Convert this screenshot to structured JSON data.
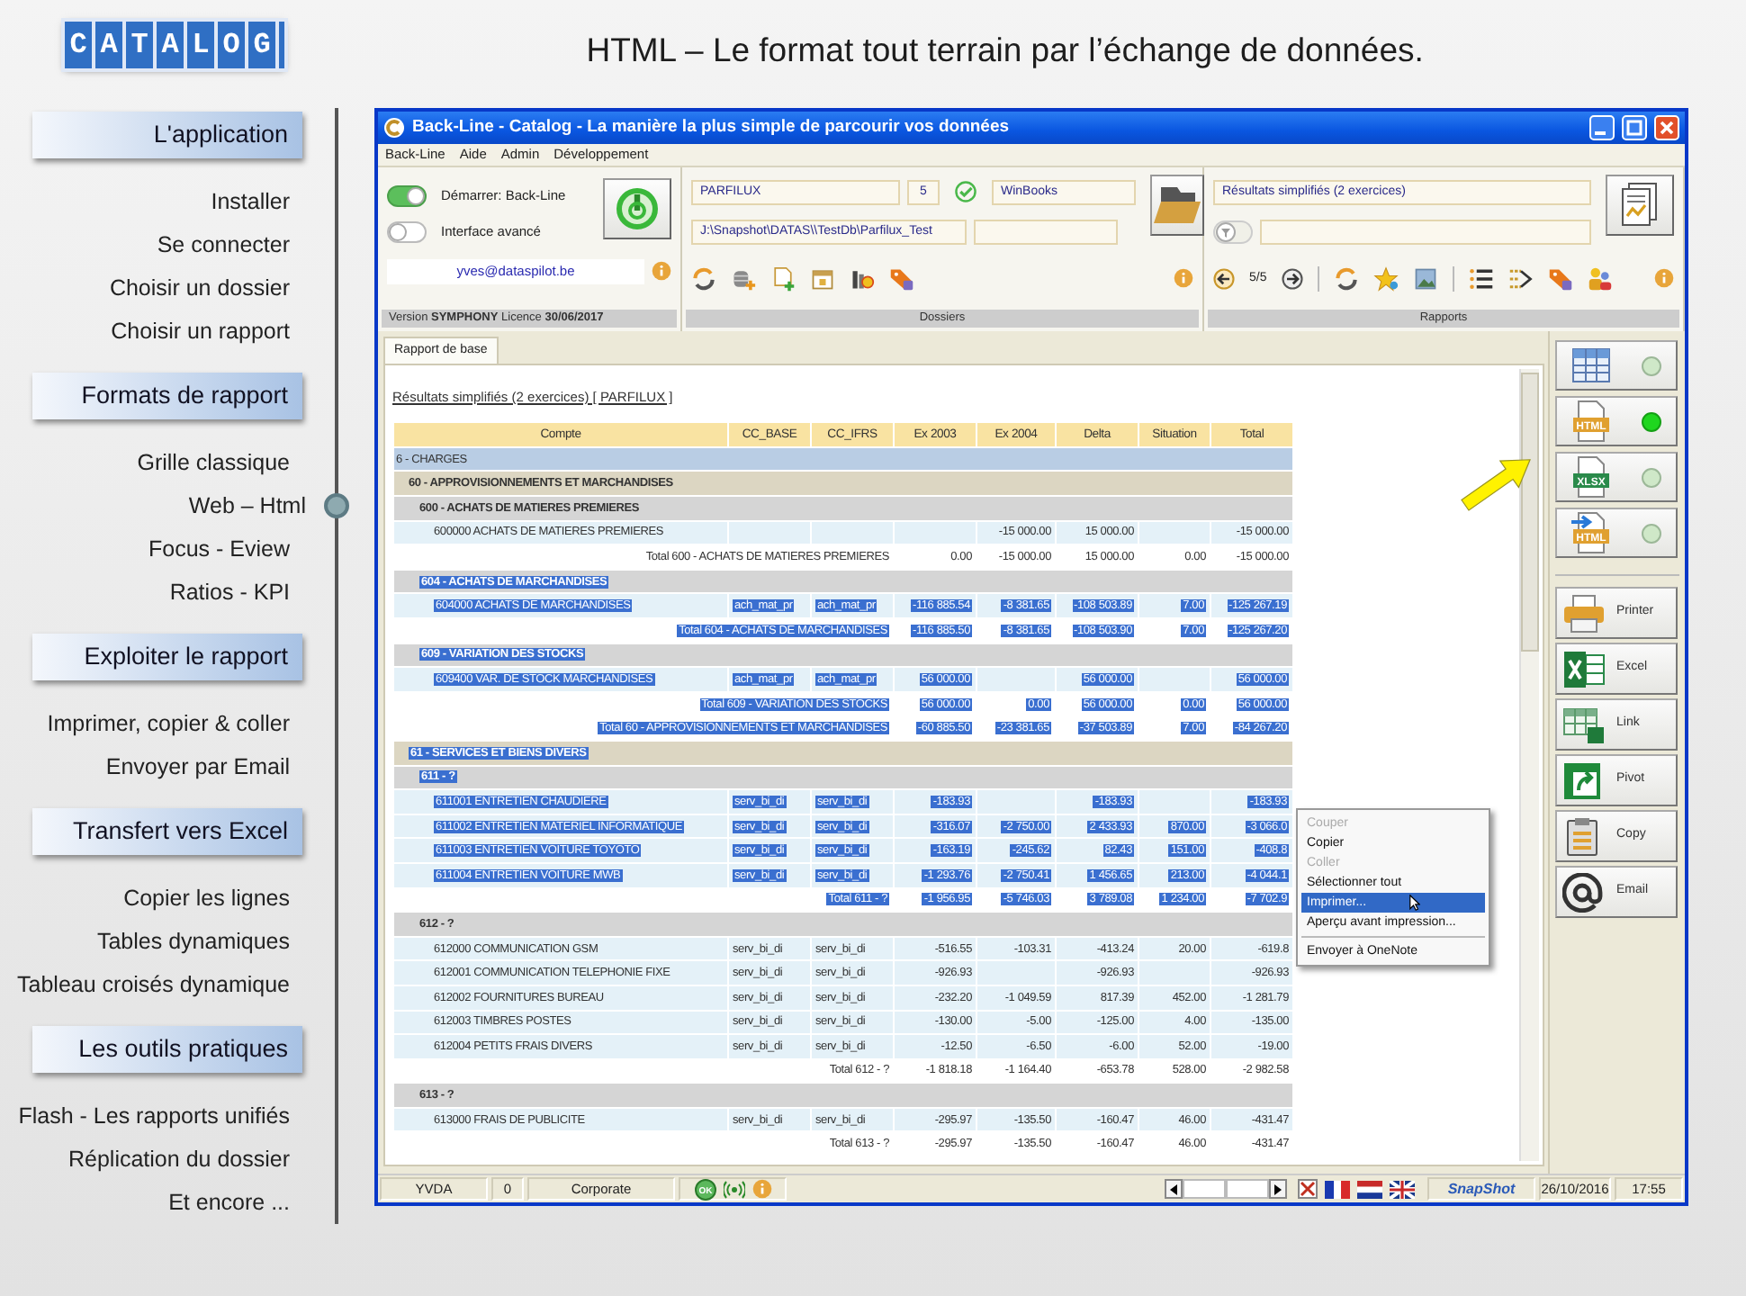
{
  "logo": "CATALOG",
  "headline": "HTML – Le format tout terrain par l’échange de données.",
  "sidebar": {
    "sections": [
      {
        "title": "L'application",
        "items": [
          {
            "label": "Installer",
            "selected": false
          },
          {
            "label": "Se connecter",
            "selected": false
          },
          {
            "label": "Choisir un dossier",
            "selected": false
          },
          {
            "label": "Choisir un rapport",
            "selected": false
          }
        ]
      },
      {
        "title": "Formats de rapport",
        "items": [
          {
            "label": "Grille classique",
            "selected": false
          },
          {
            "label": "Web – Html",
            "selected": true
          },
          {
            "label": "Focus - Eview",
            "selected": false
          },
          {
            "label": "Ratios - KPI",
            "selected": false
          }
        ]
      },
      {
        "title": "Exploiter le rapport",
        "items": [
          {
            "label": "Imprimer, copier & coller",
            "selected": false
          },
          {
            "label": "Envoyer par Email",
            "selected": false
          }
        ]
      },
      {
        "title": "Transfert vers Excel",
        "items": [
          {
            "label": "Copier les lignes",
            "selected": false
          },
          {
            "label": "Tables dynamiques",
            "selected": false
          },
          {
            "label": "Tableau croisés dynamique",
            "selected": false
          }
        ]
      },
      {
        "title": "Les outils pratiques",
        "items": [
          {
            "label": "Flash - Les rapports unifiés",
            "selected": false
          },
          {
            "label": "Réplication du dossier",
            "selected": false
          },
          {
            "label": "Et encore ...",
            "selected": false
          }
        ]
      }
    ]
  },
  "window": {
    "title": "Back-Line - Catalog - La manière la plus simple de parcourir vos données"
  },
  "menu_bar": [
    "Back-Line",
    "Aide",
    "Admin",
    "Développement"
  ],
  "session_panel": {
    "toggles": [
      {
        "label": "Démarrer: Back-Line",
        "on": true
      },
      {
        "label": "Interface avancé",
        "on": false
      }
    ],
    "email": "yves@dataspilot.be",
    "footer": "Version **SYMPHONY**  Licence **30/06/2017**"
  },
  "dossiers_panel": {
    "company": "PARFILUX",
    "number": "5",
    "software": "WinBooks",
    "path": "J:\\Snapshot\\DATAS\\\\TestDb\\Parfilux_Test",
    "footer": "Dossiers"
  },
  "reports_panel": {
    "report": "Résultats simplifiés (2 exercices)",
    "page": "5/5",
    "footer": "Rapports"
  },
  "tabs": [
    {
      "label": "Rapport de base",
      "selected": true
    }
  ],
  "report": {
    "title": "Résultats simplifiés (2 exercices) [ PARFILUX ]",
    "columns": [
      "Compte",
      "CC_BASE",
      "CC_IFRS",
      "Ex 2003",
      "Ex 2004",
      "Delta",
      "Situation",
      "Total"
    ],
    "rows": [
      {
        "kind": "class",
        "label": "6 - CHARGES",
        "selected": false
      },
      {
        "kind": "group",
        "label": "60 - APPROVISIONNEMENTS ET MARCHANDISES",
        "selected": false
      },
      {
        "kind": "subgroup",
        "label": "600 - ACHATS DE MATIERES PREMIERES",
        "selected": false
      },
      {
        "kind": "account",
        "label": "600000 ACHATS DE MATIERES PREMIERES",
        "cells": [
          null,
          null,
          null,
          "-15 000.00",
          "15 000.00",
          null,
          "-15 000.00"
        ],
        "selected": false
      },
      {
        "kind": "total",
        "label": "Total 600 - ACHATS DE MATIERES PREMIERES",
        "cells": [
          "0.00",
          "-15 000.00",
          "15 000.00",
          "0.00",
          "-15 000.00"
        ],
        "selected": false
      },
      {
        "kind": "subgroup",
        "label": "604 - ACHATS DE MARCHANDISES",
        "selected": true
      },
      {
        "kind": "account",
        "label": "604000 ACHATS DE MARCHANDISES",
        "cells": [
          "ach_mat_pr",
          "ach_mat_pr",
          "-116 885.54",
          "-8 381.65",
          "-108 503.89",
          "7.00",
          "-125 267.19"
        ],
        "selected": true
      },
      {
        "kind": "total",
        "label": "Total 604 - ACHATS DE MARCHANDISES",
        "cells": [
          "-116 885.50",
          "-8 381.65",
          "-108 503.90",
          "7.00",
          "-125 267.20"
        ],
        "selected": true
      },
      {
        "kind": "subgroup",
        "label": "609 - VARIATION DES STOCKS",
        "selected": true
      },
      {
        "kind": "account",
        "label": "609400 VAR. DE STOCK MARCHANDISES",
        "cells": [
          "ach_mat_pr",
          "ach_mat_pr",
          "56 000.00",
          null,
          "56 000.00",
          null,
          "56 000.00"
        ],
        "selected": true
      },
      {
        "kind": "total",
        "label": "Total 609 - VARIATION DES STOCKS",
        "cells": [
          "56 000.00",
          "0.00",
          "56 000.00",
          "0.00",
          "56 000.00"
        ],
        "selected": true
      },
      {
        "kind": "total",
        "label": "Total 60 - APPROVISIONNEMENTS ET MARCHANDISES",
        "cells": [
          "-60 885.50",
          "-23 381.65",
          "-37 503.89",
          "7.00",
          "-84 267.20"
        ],
        "selected": true
      },
      {
        "kind": "group",
        "label": "61 - SERVICES ET BIENS DIVERS",
        "selected": true
      },
      {
        "kind": "subgroup",
        "label": "611 - ?",
        "selected": true
      },
      {
        "kind": "account",
        "label": "611001 ENTRETIEN CHAUDIERE",
        "cells": [
          "serv_bi_di",
          "serv_bi_di",
          "-183.93",
          null,
          "-183.93",
          null,
          "-183.93"
        ],
        "selected": true
      },
      {
        "kind": "account",
        "label": "611002 ENTRETIEN MATERIEL INFORMATIQUE",
        "cells": [
          "serv_bi_di",
          "serv_bi_di",
          "-316.07",
          "-2 750.00",
          "2 433.93",
          "870.00",
          "-3 066.0"
        ],
        "selected": true
      },
      {
        "kind": "account",
        "label": "611003 ENTRETIEN VOITURE TOYOTO",
        "cells": [
          "serv_bi_di",
          "serv_bi_di",
          "-163.19",
          "-245.62",
          "82.43",
          "151.00",
          "-408.8"
        ],
        "selected": true
      },
      {
        "kind": "account",
        "label": "611004 ENTRETIEN VOITURE MWB",
        "cells": [
          "serv_bi_di",
          "serv_bi_di",
          "-1 293.76",
          "-2 750.41",
          "1 456.65",
          "213.00",
          "-4 044.1"
        ],
        "selected": true
      },
      {
        "kind": "total",
        "label": "Total 611 - ?",
        "cells": [
          "-1 956.95",
          "-5 746.03",
          "3 789.08",
          "1 234.00",
          "-7 702.9"
        ],
        "selected": true
      },
      {
        "kind": "subgroup",
        "label": "612 - ?",
        "selected": false
      },
      {
        "kind": "account",
        "label": "612000 COMMUNICATION GSM",
        "cells": [
          "serv_bi_di",
          "serv_bi_di",
          "-516.55",
          "-103.31",
          "-413.24",
          "20.00",
          "-619.8"
        ],
        "selected": false
      },
      {
        "kind": "account",
        "label": "612001 COMMUNICATION TELEPHONIE FIXE",
        "cells": [
          "serv_bi_di",
          "serv_bi_di",
          "-926.93",
          null,
          "-926.93",
          null,
          "-926.93"
        ],
        "selected": false
      },
      {
        "kind": "account",
        "label": "612002 FOURNITURES BUREAU",
        "cells": [
          "serv_bi_di",
          "serv_bi_di",
          "-232.20",
          "-1 049.59",
          "817.39",
          "452.00",
          "-1 281.79"
        ],
        "selected": false
      },
      {
        "kind": "account",
        "label": "612003 TIMBRES POSTES",
        "cells": [
          "serv_bi_di",
          "serv_bi_di",
          "-130.00",
          "-5.00",
          "-125.00",
          "4.00",
          "-135.00"
        ],
        "selected": false
      },
      {
        "kind": "account",
        "label": "612004 PETITS FRAIS DIVERS",
        "cells": [
          "serv_bi_di",
          "serv_bi_di",
          "-12.50",
          "-6.50",
          "-6.00",
          "52.00",
          "-19.00"
        ],
        "selected": false
      },
      {
        "kind": "total",
        "label": "Total 612 - ?",
        "cells": [
          "-1 818.18",
          "-1 164.40",
          "-653.78",
          "528.00",
          "-2 982.58"
        ],
        "selected": false
      },
      {
        "kind": "subgroup",
        "label": "613 - ?",
        "selected": false
      },
      {
        "kind": "account",
        "label": "613000 FRAIS DE PUBLICITE",
        "cells": [
          "serv_bi_di",
          "serv_bi_di",
          "-295.97",
          "-135.50",
          "-160.47",
          "46.00",
          "-431.47"
        ],
        "selected": false
      },
      {
        "kind": "total",
        "label": "Total 613 - ?",
        "cells": [
          "-295.97",
          "-135.50",
          "-160.47",
          "46.00",
          "-431.47"
        ],
        "selected": false
      }
    ]
  },
  "context_menu": [
    {
      "kind": "item",
      "label": "Couper",
      "disabled": true,
      "selected": false
    },
    {
      "kind": "item",
      "label": "Copier",
      "disabled": false,
      "selected": false
    },
    {
      "kind": "item",
      "label": "Coller",
      "disabled": true,
      "selected": false
    },
    {
      "kind": "item",
      "label": "Sélectionner tout",
      "disabled": false,
      "selected": false
    },
    {
      "kind": "item",
      "label": "Imprimer...",
      "disabled": false,
      "selected": true
    },
    {
      "kind": "item",
      "label": "Aperçu avant impression...",
      "disabled": false,
      "selected": false
    },
    {
      "kind": "separator"
    },
    {
      "kind": "item",
      "label": "Envoyer à OneNote",
      "disabled": false,
      "selected": false
    }
  ],
  "export_formats": [
    {
      "kind": "grid",
      "on": false
    },
    {
      "kind": "html",
      "label": "HTML",
      "on": true
    },
    {
      "kind": "xlsx",
      "label": "XLSX",
      "on": false
    },
    {
      "kind": "html-export",
      "label": "HTML",
      "on": false
    }
  ],
  "actions": [
    {
      "kind": "printer",
      "label": "Printer"
    },
    {
      "kind": "excel",
      "label": "Excel"
    },
    {
      "kind": "link",
      "label": "Link"
    },
    {
      "kind": "pivot",
      "label": "Pivot"
    },
    {
      "kind": "copy",
      "label": "Copy"
    },
    {
      "kind": "email",
      "label": "Email"
    }
  ],
  "status_bar": {
    "user": "YVDA",
    "count": "0",
    "profile": "Corporate",
    "ok_badge": "OK",
    "brand": "SnapShot",
    "date": "26/10/2016",
    "time": "17:55"
  }
}
